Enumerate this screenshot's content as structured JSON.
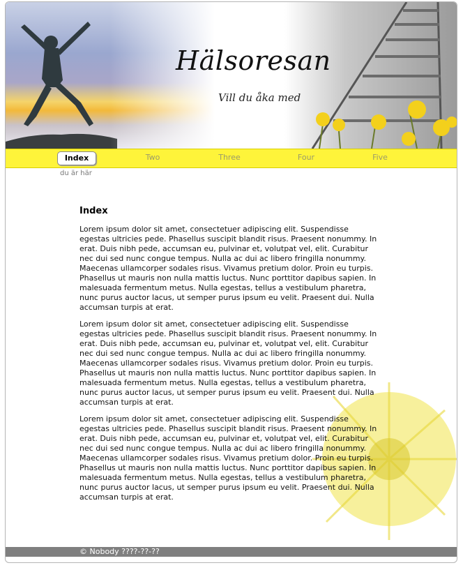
{
  "header": {
    "title": "Hälsoresan",
    "subtitle": "Vill du åka med"
  },
  "nav": {
    "items": [
      {
        "label": "Index",
        "active": true
      },
      {
        "label": "Two",
        "active": false
      },
      {
        "label": "Three",
        "active": false
      },
      {
        "label": "Four",
        "active": false
      },
      {
        "label": "Five",
        "active": false
      }
    ]
  },
  "breadcrumb": "du är här",
  "main": {
    "heading": "Index",
    "paragraphs": [
      "Lorem ipsum dolor sit amet, consectetuer adipiscing elit. Suspendisse egestas ultricies pede. Phasellus suscipit blandit risus. Praesent nonummy. In erat. Duis nibh pede, accumsan eu, pulvinar et, volutpat vel, elit. Curabitur nec dui sed nunc congue tempus. Nulla ac dui ac libero fringilla nonummy. Maecenas ullamcorper sodales risus. Vivamus pretium dolor. Proin eu turpis. Phasellus ut mauris non nulla mattis luctus. Nunc porttitor dapibus sapien. In malesuada fermentum metus. Nulla egestas, tellus a vestibulum pharetra, nunc purus auctor lacus, ut semper purus ipsum eu velit. Praesent dui. Nulla accumsan turpis at erat.",
      "Lorem ipsum dolor sit amet, consectetuer adipiscing elit. Suspendisse egestas ultricies pede. Phasellus suscipit blandit risus. Praesent nonummy. In erat. Duis nibh pede, accumsan eu, pulvinar et, volutpat vel, elit. Curabitur nec dui sed nunc congue tempus. Nulla ac dui ac libero fringilla nonummy. Maecenas ullamcorper sodales risus. Vivamus pretium dolor. Proin eu turpis. Phasellus ut mauris non nulla mattis luctus. Nunc porttitor dapibus sapien. In malesuada fermentum metus. Nulla egestas, tellus a vestibulum pharetra, nunc purus auctor lacus, ut semper purus ipsum eu velit. Praesent dui. Nulla accumsan turpis at erat.",
      "Lorem ipsum dolor sit amet, consectetuer adipiscing elit. Suspendisse egestas ultricies pede. Phasellus suscipit blandit risus. Praesent nonummy. In erat. Duis nibh pede, accumsan eu, pulvinar et, volutpat vel, elit. Curabitur nec dui sed nunc congue tempus. Nulla ac dui ac libero fringilla nonummy. Maecenas ullamcorper sodales risus. Vivamus pretium dolor. Proin eu turpis. Phasellus ut mauris non nulla mattis luctus. Nunc porttitor dapibus sapien. In malesuada fermentum metus. Nulla egestas, tellus a vestibulum pharetra, nunc purus auctor lacus, ut semper purus ipsum eu velit. Praesent dui. Nulla accumsan turpis at erat."
    ]
  },
  "footer": {
    "text": "© Nobody ????-??-??"
  },
  "colors": {
    "nav_bg": "#fef43a",
    "footer_bg": "#7f7f7f",
    "flower": "#f2e64a"
  }
}
